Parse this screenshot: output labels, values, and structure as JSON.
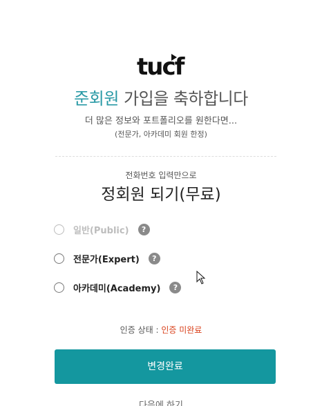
{
  "logo": {
    "text": "tucf"
  },
  "title": {
    "accent": "준회원",
    "rest": " 가입을 축하합니다"
  },
  "subtitle": "더 많은 정보와 포트폴리오를 원한다면...",
  "subnote": "(전문가, 아카데미 회원 한정)",
  "phone_hint": "전화번호 입력만으로",
  "heading": "정회원 되기(무료)",
  "options": [
    {
      "label": "일반(Public)",
      "disabled": true,
      "help": "?"
    },
    {
      "label": "전문가(Expert)",
      "disabled": false,
      "help": "?"
    },
    {
      "label": "아카데미(Academy)",
      "disabled": false,
      "help": "?"
    }
  ],
  "auth": {
    "label": "인증 상태 : ",
    "value": "인증 미완료"
  },
  "submit_label": "변경완료",
  "later_label": "다음에 하기",
  "colors": {
    "accent": "#2a9aa6",
    "button": "#14979f",
    "status": "#d9401a"
  }
}
